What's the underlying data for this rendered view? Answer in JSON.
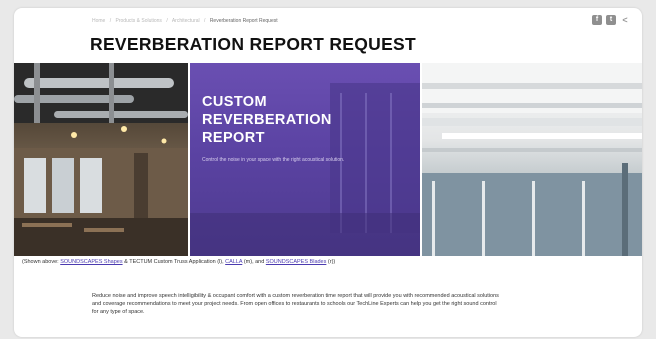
{
  "breadcrumb": {
    "items": [
      "Home",
      "Products & Solutions",
      "Architectural"
    ],
    "current": "Reverberation Report Request"
  },
  "share": {
    "icons": [
      "facebook-icon",
      "twitter-icon",
      "share-icon"
    ],
    "glyphs": [
      "f",
      "t",
      "<"
    ]
  },
  "page": {
    "title": "REVERBERATION REPORT REQUEST"
  },
  "hero": {
    "promo_title": "CUSTOM\nREVERBERATION\nREPORT",
    "promo_text": "Control the noise in your space with the right acoustical solution."
  },
  "caption": {
    "prefix": "(Shown above: ",
    "link1": "SOUNDSCAPES Shapes",
    "middle1": " & TECTUM Custom Truss Application (l), ",
    "link2": "CALLA",
    "middle2": " (m), and ",
    "link3": "SOUNDSCAPES Blades",
    "suffix": " (r))"
  },
  "body": {
    "paragraph": "Reduce noise and improve speech intelligibility & occupant comfort with a custom reverberation time report that will provide you with recommended acoustical solutions and coverage recommendations to meet your project needs. From open offices to restaurants to schools our TechLine Experts can help you get the right sound control for any type of space."
  },
  "colors": {
    "promo_purple": "#5b43a3",
    "link": "#4b3bb0",
    "background": "#e9e9e9"
  }
}
